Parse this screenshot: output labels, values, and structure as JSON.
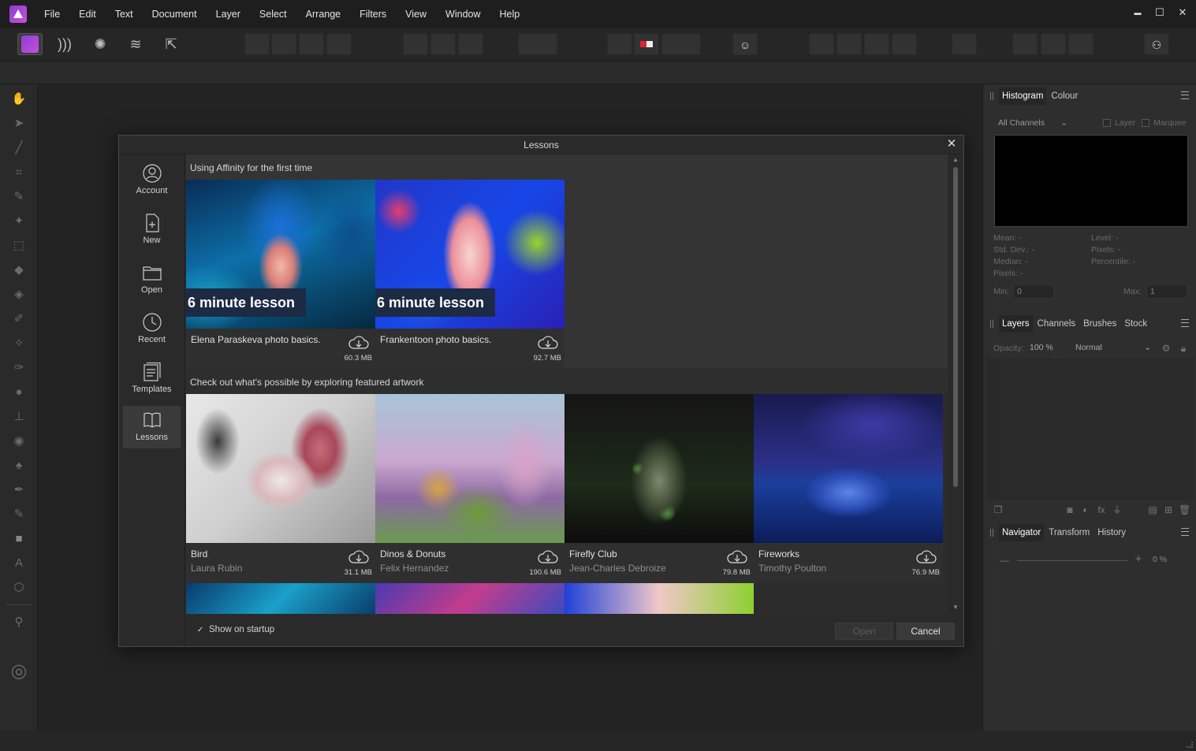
{
  "menubar": {
    "items": [
      "File",
      "Edit",
      "Text",
      "Document",
      "Layer",
      "Select",
      "Arrange",
      "Filters",
      "View",
      "Window",
      "Help"
    ]
  },
  "window_controls": {
    "minimize": "▬",
    "maximize": "☐",
    "close": "✕"
  },
  "personas": [
    "photo-persona-icon",
    "liquify-persona-icon",
    "develop-persona-icon",
    "tone-mapping-persona-icon",
    "export-persona-icon"
  ],
  "histogram_panel": {
    "tabs": [
      "Histogram",
      "Colour"
    ],
    "channel_select": "All Channels",
    "layer_label": "Layer",
    "marquee_label": "Marquee",
    "stats_left": [
      "Mean: -",
      "Std. Dev.: -",
      "Median: -",
      "Pixels: -"
    ],
    "stats_right": [
      "Level: -",
      "Pixels: -",
      "Percentile: -"
    ],
    "min_label": "Min:",
    "min_value": "0",
    "max_label": "Max:",
    "max_value": "1"
  },
  "layers_panel": {
    "tabs": [
      "Layers",
      "Channels",
      "Brushes",
      "Stock"
    ],
    "opacity_label": "Opacity:",
    "opacity_value": "100 %",
    "blend_mode": "Normal"
  },
  "navigator_panel": {
    "tabs": [
      "Navigator",
      "Transform",
      "History"
    ],
    "zoom_value": "0 %",
    "minus": "—",
    "plus": "+"
  },
  "dialog": {
    "title": "Lessons",
    "close": "✕",
    "sidebar": [
      {
        "label": "Account"
      },
      {
        "label": "New"
      },
      {
        "label": "Open"
      },
      {
        "label": "Recent"
      },
      {
        "label": "Templates"
      },
      {
        "label": "Lessons"
      }
    ],
    "section1": {
      "heading": "Using Affinity for the first time",
      "cards": [
        {
          "badge": "6 minute lesson",
          "title": "Elena Paraskeva photo basics.",
          "size": "60.3 MB"
        },
        {
          "badge": "6 minute lesson",
          "title": "Frankentoon photo basics.",
          "size": "92.7 MB"
        }
      ]
    },
    "section2": {
      "heading": "Check out what's possible by exploring featured artwork",
      "cards": [
        {
          "title": "Bird",
          "author": "Laura Rubin",
          "size": "31.1 MB"
        },
        {
          "title": "Dinos & Donuts",
          "author": "Felix Hernandez",
          "size": "190.6 MB"
        },
        {
          "title": "Firefly Club",
          "author": "Jean-Charles Debroize",
          "size": "79.8 MB"
        },
        {
          "title": "Fireworks",
          "author": "Timothy Poulton",
          "size": "76.9 MB"
        }
      ]
    },
    "footer": {
      "show_on_startup": "Show on startup",
      "checkmark": "✓",
      "open_button": "Open",
      "cancel_button": "Cancel"
    }
  }
}
